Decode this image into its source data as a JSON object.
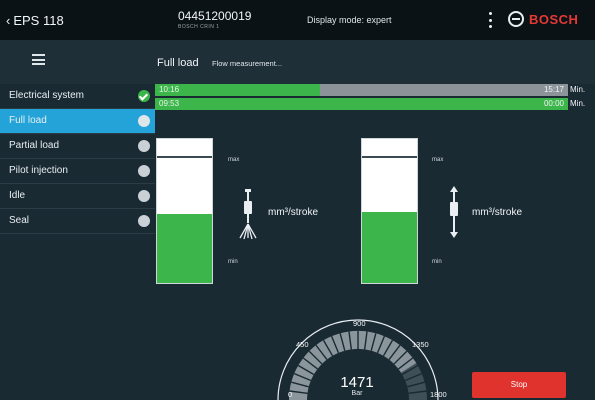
{
  "header": {
    "back_label": "EPS 118",
    "device_number": "04451200019",
    "device_sub": "BOSCH CRIN 1",
    "display_mode": "Display mode: expert",
    "brand": "BOSCH"
  },
  "subheader": {
    "title": "Full load",
    "subtitle": "Flow measurement..."
  },
  "sidebar": {
    "items": [
      {
        "label": "Electrical system",
        "state": "done"
      },
      {
        "label": "Full load",
        "state": "active"
      },
      {
        "label": "Partial load",
        "state": "pending"
      },
      {
        "label": "Pilot injection",
        "state": "pending"
      },
      {
        "label": "Idle",
        "state": "pending"
      },
      {
        "label": "Seal",
        "state": "pending"
      }
    ]
  },
  "timers": [
    {
      "elapsed": "10:16",
      "remaining": "15:17",
      "unit": "Min.",
      "progress": 0.4
    },
    {
      "elapsed": "09:53",
      "remaining": "00:00",
      "unit": "Min.",
      "progress": 1.0
    }
  ],
  "gauges": [
    {
      "max_label": "max",
      "min_label": "min",
      "unit": "mm³/stroke",
      "level": 0.48
    },
    {
      "max_label": "max",
      "min_label": "min",
      "unit": "mm³/stroke",
      "level": 0.49
    }
  ],
  "pressure": {
    "value": "1471",
    "unit": "Bar",
    "ticks": [
      "0",
      "450",
      "900",
      "1350",
      "1800"
    ],
    "fraction": 0.82
  },
  "buttons": {
    "stop_label": "Stop"
  },
  "colors": {
    "accent": "#23a3d8",
    "success": "#3cb54a",
    "danger": "#e0332e",
    "brand": "#e53935"
  }
}
